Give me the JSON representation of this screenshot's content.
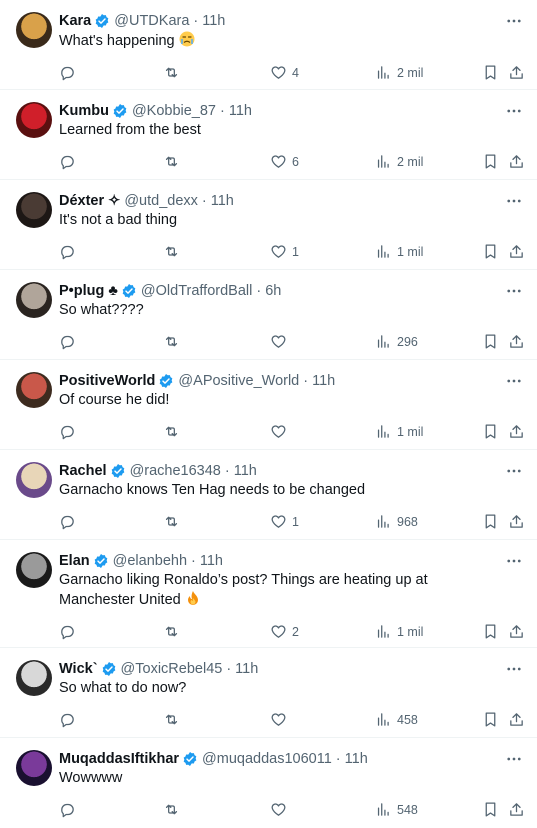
{
  "tweets": [
    {
      "name": "Kara",
      "verified": true,
      "handle": "@UTDKara",
      "time": "11h",
      "text": "What's happening",
      "text_emoji": "crying-face-emoji",
      "likes": "4",
      "views": "2 mil",
      "avatar_color": "#d9a14a",
      "avatar_dark": "#3a2a1a"
    },
    {
      "name": "Kumbu",
      "verified": true,
      "handle": "@Kobbie_87",
      "time": "11h",
      "text": "Learned from the best",
      "likes": "6",
      "views": "2 mil",
      "avatar_color": "#d01f2a",
      "avatar_dark": "#5a1010"
    },
    {
      "name": "Déxter ✧",
      "verified": false,
      "handle": "@utd_dexx",
      "time": "11h",
      "text": "It's not a bad thing",
      "likes": "1",
      "views": "1 mil",
      "avatar_color": "#4a3b34",
      "avatar_dark": "#1d1715"
    },
    {
      "name": "P•plug ♣",
      "verified": true,
      "handle": "@OldTraffordBall",
      "time": "6h",
      "text": "So what????",
      "likes": "",
      "views": "296",
      "avatar_color": "#b0a59a",
      "avatar_dark": "#2a2420"
    },
    {
      "name": "PositiveWorld",
      "verified": true,
      "handle": "@APositive_World",
      "time": "11h",
      "text": "Of course he did!",
      "likes": "",
      "views": "1 mil",
      "avatar_color": "#c9584a",
      "avatar_dark": "#3d2b1f"
    },
    {
      "name": "Rachel",
      "verified": true,
      "handle": "@rache16348",
      "time": "11h",
      "text": "Garnacho knows Ten Hag needs to be changed",
      "likes": "1",
      "views": "968",
      "avatar_color": "#e8d6b8",
      "avatar_dark": "#6a4a8a"
    },
    {
      "name": "Elan",
      "verified": true,
      "handle": "@elanbehh",
      "time": "11h",
      "text": "Garnacho liking Ronaldo’s post? Things are heating up at Manchester United",
      "text_emoji": "fire-emoji",
      "likes": "2",
      "views": "1 mil",
      "avatar_color": "#9a9a9a",
      "avatar_dark": "#1a1a1a"
    },
    {
      "name": "Wick`",
      "verified": true,
      "handle": "@ToxicRebel45",
      "time": "11h",
      "text": "So what to do now?",
      "likes": "",
      "views": "458",
      "avatar_color": "#d8d8d8",
      "avatar_dark": "#2a2a2a"
    },
    {
      "name": "MuqaddasIftikhar",
      "verified": true,
      "handle": "@muqaddas106011",
      "time": "11h",
      "text": "Wowwww",
      "likes": "",
      "views": "548",
      "avatar_color": "#7a3a9a",
      "avatar_dark": "#1a1030"
    }
  ],
  "colors": {
    "verified": "#1d9bf0",
    "secondary": "#536471",
    "text": "#0f1419",
    "divider": "#eff3f4"
  }
}
